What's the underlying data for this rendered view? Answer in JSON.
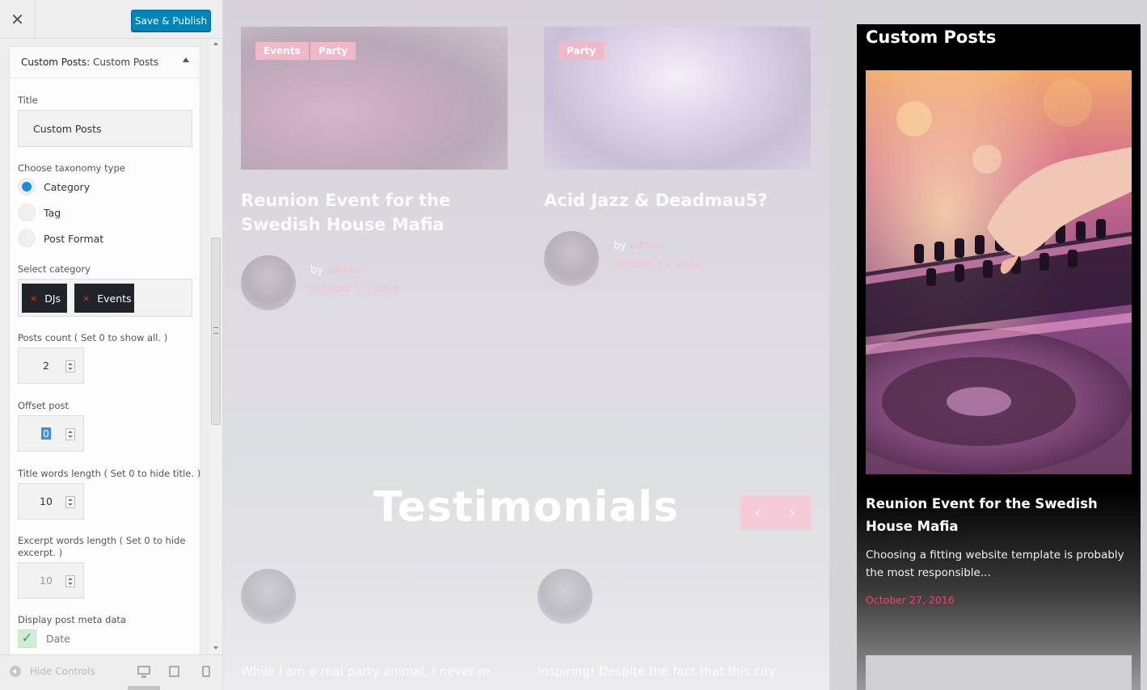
{
  "header": {
    "close_symbol": "✕",
    "publish_label": "Save & Publish"
  },
  "widget": {
    "type_label": "Custom Posts:",
    "instance_title": "Custom Posts",
    "title_label": "Title",
    "title_value": "Custom Posts",
    "taxonomy_label": "Choose taxonomy type",
    "taxonomy_options": [
      "Category",
      "Tag",
      "Post Format"
    ],
    "taxonomy_selected": "Category",
    "select_category_label": "Select category",
    "selected_categories": [
      "DJs",
      "Events"
    ],
    "chip_remove_symbol": "×",
    "posts_count_label": "Posts count ( Set 0 to show all. )",
    "posts_count_value": "2",
    "offset_label": "Offset post",
    "offset_value": "0",
    "title_words_label": "Title words length ( Set 0 to hide title. )",
    "title_words_value": "10",
    "excerpt_words_label_1": "Excerpt words length ( Set 0 to hide",
    "excerpt_words_label_2": "excerpt. )",
    "excerpt_words_value": "10",
    "meta_label": "Display post meta data",
    "meta_date_label": "Date",
    "meta_date_checked": true,
    "check_symbol": "✓"
  },
  "footer": {
    "hide_controls_label": "Hide Controls"
  },
  "preview": {
    "posts": [
      {
        "tags": [
          "Events",
          "Party"
        ],
        "title": "Reunion Event for the Swedish House Mafia",
        "by": "by",
        "author": "admin",
        "date": "October 27, 2016"
      },
      {
        "tags": [
          "Party"
        ],
        "title": "Acid Jazz & Deadmau5?",
        "by": "by",
        "author": "admin",
        "date": "October 19, 2016"
      }
    ],
    "testimonials_heading": "Testimonials",
    "prev_symbol": "‹",
    "next_symbol": "›",
    "quotes": [
      "While I am a real party animal, I never re",
      "Inspiring! Despite the fact that this city"
    ],
    "sidebar_widget": {
      "heading": "Custom Posts",
      "post_title": "Reunion Event for the Swedish House Mafia",
      "excerpt": "Choosing a fitting website template is probably the most responsible...",
      "date": "October 27, 2016"
    }
  },
  "colors": {
    "publish_button": "#0085ba",
    "radio_selected": "#1e8cde",
    "tag_pink": "#f1b8c7",
    "date_accent": "#ef4565"
  }
}
